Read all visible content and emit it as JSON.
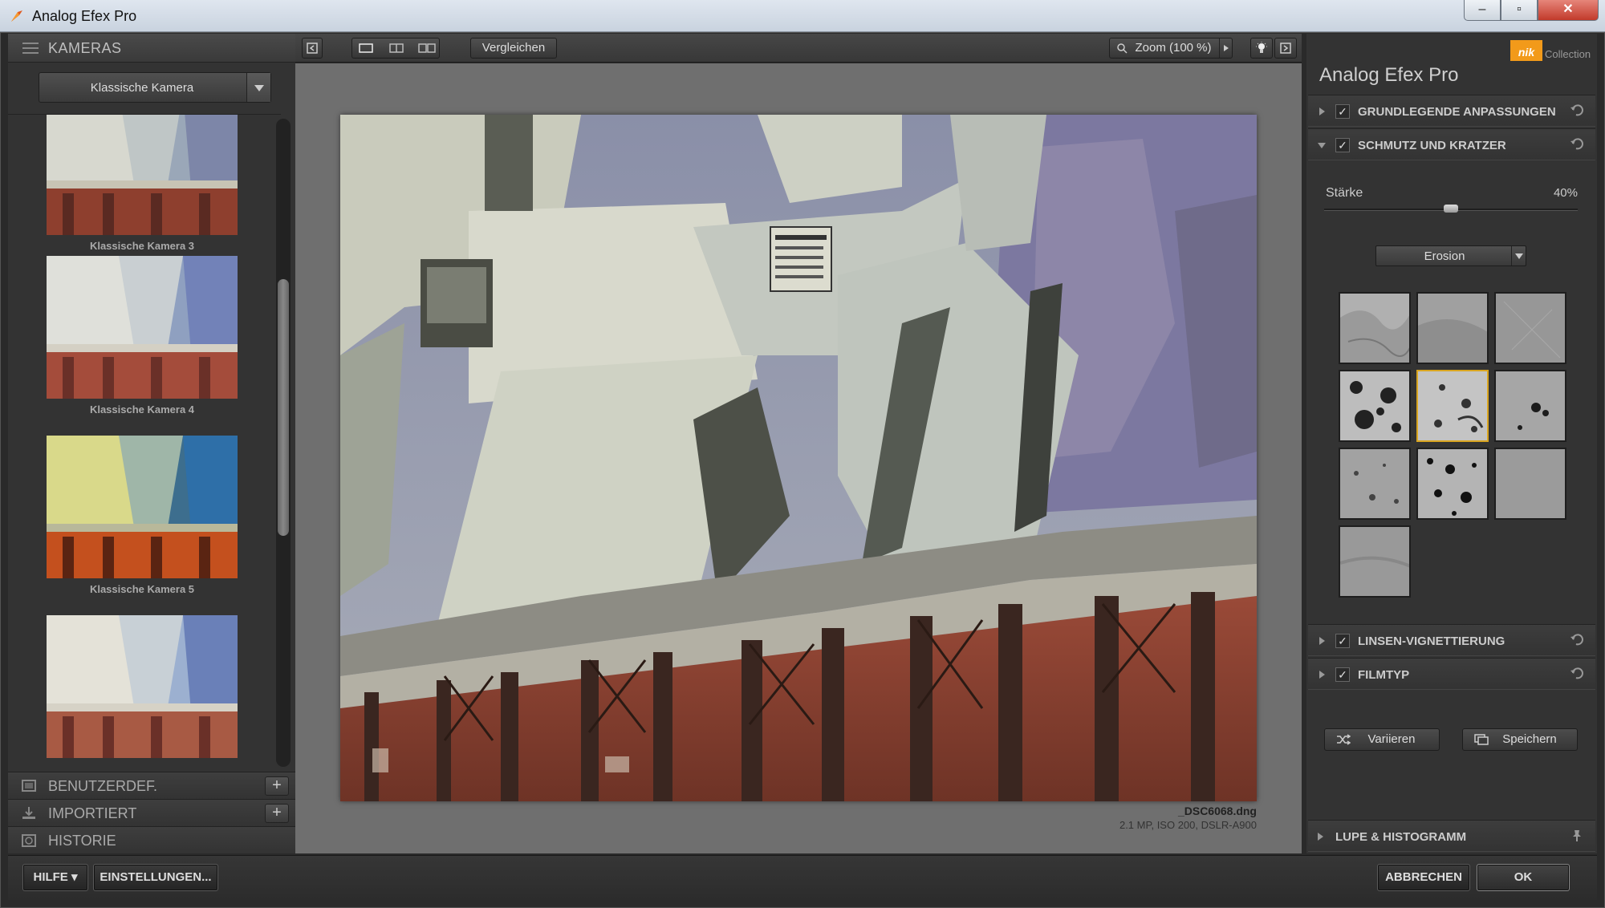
{
  "window": {
    "title": "Analog Efex Pro",
    "minimize": "–",
    "maximize": "▫",
    "close": "✕"
  },
  "left_panel": {
    "header": "KAMERAS",
    "dropdown_value": "Klassische Kamera",
    "thumbnails": [
      {
        "caption": "Klassische Kamera 3"
      },
      {
        "caption": "Klassische Kamera 4"
      },
      {
        "caption": "Klassische Kamera 5"
      },
      {
        "caption": ""
      }
    ],
    "sections": [
      {
        "label": "BENUTZERDEF.",
        "plus": "+"
      },
      {
        "label": "IMPORTIERT",
        "plus": "+"
      },
      {
        "label": "HISTORIE"
      }
    ]
  },
  "toolbar": {
    "compare": "Vergleichen",
    "zoom": "Zoom (100 %)"
  },
  "image": {
    "filename": "_DSC6068.dng",
    "meta": "2.1 MP, ISO 200, DSLR-A900"
  },
  "right_panel": {
    "brand": "nik",
    "brand_suffix": "Collection",
    "title": "Analog Efex Pro",
    "sections": {
      "basic": "GRUNDLEGENDE ANPASSUNGEN",
      "dirt": "SCHMUTZ UND KRATZER",
      "vignette": "LINSEN-VIGNETTIERUNG",
      "film": "FILMTYP",
      "loupe": "LUPE & HISTOGRAMM"
    },
    "strength_label": "Stärke",
    "strength_value": "40%",
    "strength_fraction": 0.4,
    "texture_dropdown": "Erosion",
    "vary_button": "Variieren",
    "save_button": "Speichern"
  },
  "bottom": {
    "help": "HILFE ▾",
    "settings": "EINSTELLUNGEN...",
    "cancel": "ABBRECHEN",
    "ok": "OK"
  },
  "colors": {
    "accent": "#d9a520",
    "brand": "#f29a1a"
  }
}
